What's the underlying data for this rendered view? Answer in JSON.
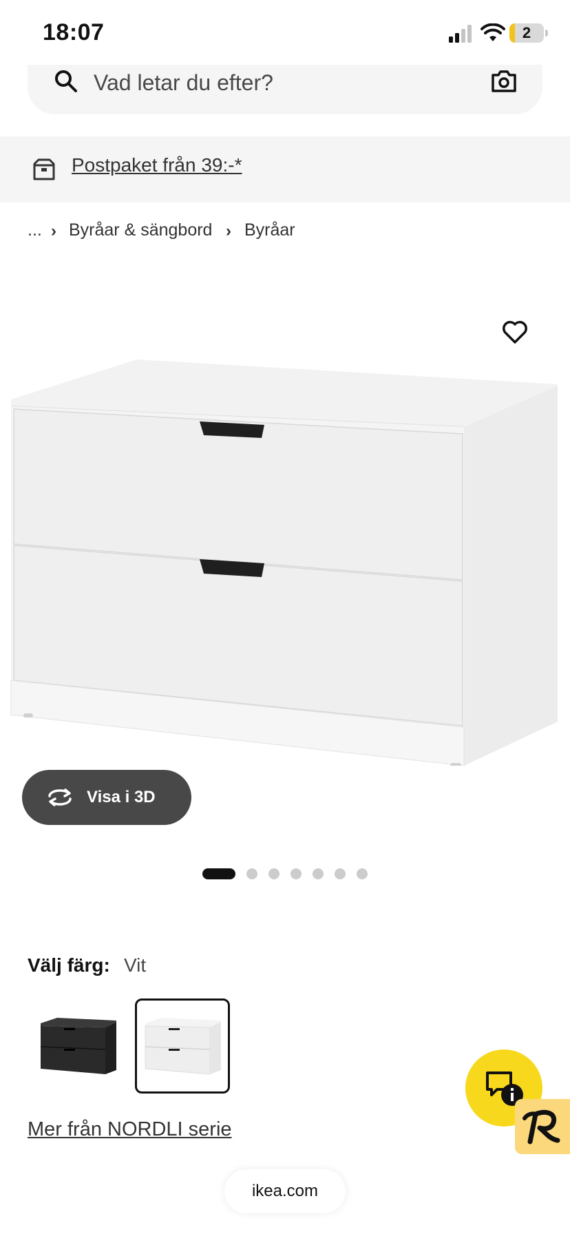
{
  "status_bar": {
    "time": "18:07",
    "battery": "2"
  },
  "search": {
    "placeholder": "Vad letar du efter?"
  },
  "promo": {
    "text": "Postpaket från 39:-*"
  },
  "breadcrumb": {
    "ellipsis": "...",
    "items": [
      "Byråar & sängbord",
      "Byråar"
    ]
  },
  "product": {
    "view_3d_label": "Visa i 3D",
    "carousel": {
      "total": 7,
      "active": 1
    }
  },
  "color_selector": {
    "label": "Välj färg:",
    "selected": "Vit",
    "options": [
      {
        "color": "#2a2a2a",
        "selected": false
      },
      {
        "color": "#f0f0f0",
        "selected": true
      }
    ]
  },
  "series_link": "Mer från NORDLI serie",
  "url_bar": {
    "domain": "ikea.com"
  },
  "colors": {
    "chat_button": "#f8d81c",
    "badge": "#fcd87c",
    "pill_dark": "#484848"
  },
  "icons": [
    "search-icon",
    "camera-icon",
    "box-icon",
    "heart-icon",
    "rotate-icon",
    "chat-info-icon",
    "r-logo-icon"
  ]
}
